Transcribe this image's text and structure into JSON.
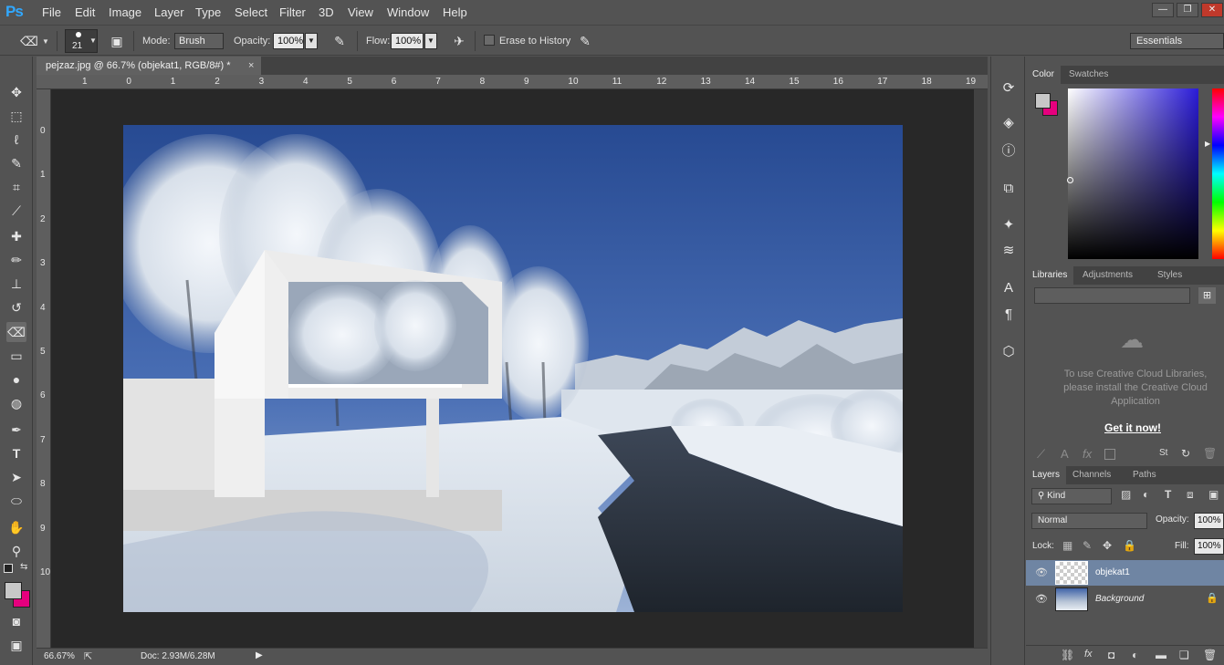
{
  "app": {
    "logo": "Ps",
    "accent": "#31a8ff"
  },
  "menu": [
    "File",
    "Edit",
    "Image",
    "Layer",
    "Type",
    "Select",
    "Filter",
    "3D",
    "View",
    "Window",
    "Help"
  ],
  "window_controls": [
    "minimize-icon",
    "restore-icon",
    "close-icon"
  ],
  "options": {
    "brush_size": "21",
    "mode_label": "Mode:",
    "mode_value": "Brush",
    "opacity_label": "Opacity:",
    "opacity_value": "100%",
    "flow_label": "Flow:",
    "flow_value": "100%",
    "erase_history_label": "Erase to History",
    "erase_history_checked": false,
    "workspace": "Essentials"
  },
  "document": {
    "tab_title": "pejzaz.jpg @ 66.7% (objekat1, RGB/8#) *",
    "close": "×",
    "ruler_top": [
      "1",
      "0",
      "1",
      "2",
      "3",
      "4",
      "5",
      "6",
      "7",
      "8",
      "9",
      "10",
      "11",
      "12",
      "13",
      "14",
      "15",
      "16",
      "17",
      "18",
      "19"
    ],
    "ruler_left": [
      "0",
      "1",
      "2",
      "3",
      "4",
      "5",
      "6",
      "7",
      "8",
      "9",
      "10"
    ]
  },
  "status": {
    "zoom": "66.67%",
    "doc": "Doc: 2.93M/6.28M"
  },
  "tools": [
    "move-icon",
    "marquee-icon",
    "lasso-icon",
    "quick-select-icon",
    "crop-icon",
    "eyedropper-icon",
    "healing-icon",
    "brush-icon",
    "stamp-icon",
    "history-brush-icon",
    "eraser-icon",
    "gradient-icon",
    "blur-icon",
    "dodge-icon",
    "pen-icon",
    "type-icon",
    "path-select-icon",
    "ellipse-icon",
    "hand-icon",
    "zoom-icon"
  ],
  "active_tool": "eraser-icon",
  "colors": {
    "foreground": "#c8c8c8",
    "background": "#e6007e"
  },
  "dock_icons": [
    "history-icon",
    "actions-icon",
    "info-icon",
    "clone-source-icon",
    "brushes-icon",
    "brush-presets-icon",
    "character-icon",
    "paragraph-icon",
    "3d-icon"
  ],
  "color_panel": {
    "tabs": [
      "Color",
      "Swatches"
    ],
    "active": "Color"
  },
  "libraries_panel": {
    "tabs": [
      "Libraries",
      "Adjustments",
      "Styles"
    ],
    "active": "Libraries",
    "message": "To use Creative Cloud Libraries, please install the Creative Cloud Application",
    "link": "Get it now!"
  },
  "layers_panel": {
    "tabs": [
      "Layers",
      "Channels",
      "Paths"
    ],
    "active": "Layers",
    "filter": "Kind",
    "blend_mode": "Normal",
    "opacity_label": "Opacity:",
    "opacity_value": "100%",
    "lock_label": "Lock:",
    "fill_label": "Fill:",
    "fill_value": "100%",
    "layers": [
      {
        "name": "objekat1",
        "selected": true,
        "visible": true
      },
      {
        "name": "Background",
        "selected": false,
        "visible": true,
        "locked": true
      }
    ]
  }
}
